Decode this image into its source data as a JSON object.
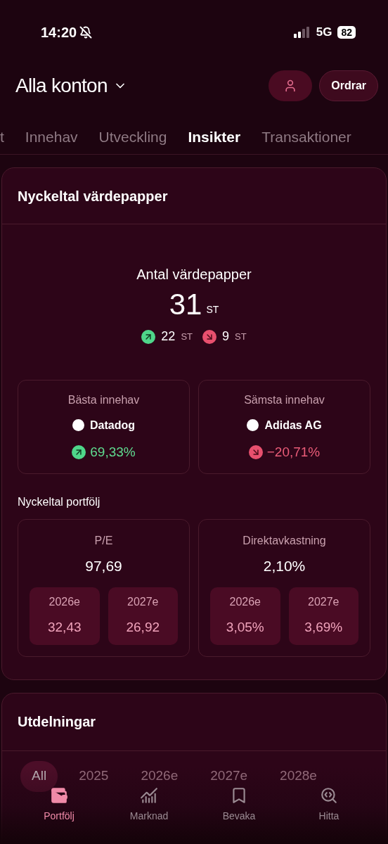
{
  "status_bar": {
    "time": "14:20",
    "network": "5G",
    "battery": "82"
  },
  "header": {
    "title": "Alla konton",
    "orders_button": "Ordrar"
  },
  "tabs": [
    {
      "label": "t",
      "selected": false
    },
    {
      "label": "Innehav",
      "selected": false
    },
    {
      "label": "Utveckling",
      "selected": false
    },
    {
      "label": "Insikter",
      "selected": true
    },
    {
      "label": "Transaktioner",
      "selected": false
    }
  ],
  "securities_card": {
    "title": "Nyckeltal värdepapper",
    "count_label": "Antal värdepapper",
    "count": "31",
    "count_unit": "ST",
    "up_count": "22",
    "up_unit": "ST",
    "down_count": "9",
    "down_unit": "ST",
    "holdings": [
      {
        "label": "Bästa innehav",
        "name": "Datadog",
        "change": "69,33%",
        "kind": "up"
      },
      {
        "label": "Sämsta innehav",
        "name": "Adidas AG",
        "change": "−20,71%",
        "kind": "down"
      }
    ],
    "portfolio_title": "Nyckeltal portfölj",
    "metrics": [
      {
        "label": "P/E",
        "value": "97,69",
        "forecasts": [
          {
            "year": "2026e",
            "value": "32,43"
          },
          {
            "year": "2027e",
            "value": "26,92"
          }
        ]
      },
      {
        "label": "Direktavkastning",
        "value": "2,10%",
        "forecasts": [
          {
            "year": "2026e",
            "value": "3,05%"
          },
          {
            "year": "2027e",
            "value": "3,69%"
          }
        ]
      }
    ]
  },
  "dividends_card": {
    "title": "Utdelningar",
    "chips": [
      {
        "label": "All",
        "selected": true
      },
      {
        "label": "2025",
        "selected": false
      },
      {
        "label": "2026e",
        "selected": false
      },
      {
        "label": "2027e",
        "selected": false
      },
      {
        "label": "2028e",
        "selected": false
      }
    ]
  },
  "bottom_nav": [
    {
      "label": "Portfölj",
      "kind": "wallet",
      "selected": true
    },
    {
      "label": "Marknad",
      "kind": "chart",
      "selected": false
    },
    {
      "label": "Bevaka",
      "kind": "bookmark",
      "selected": false
    },
    {
      "label": "Hitta",
      "kind": "search",
      "selected": false
    }
  ]
}
